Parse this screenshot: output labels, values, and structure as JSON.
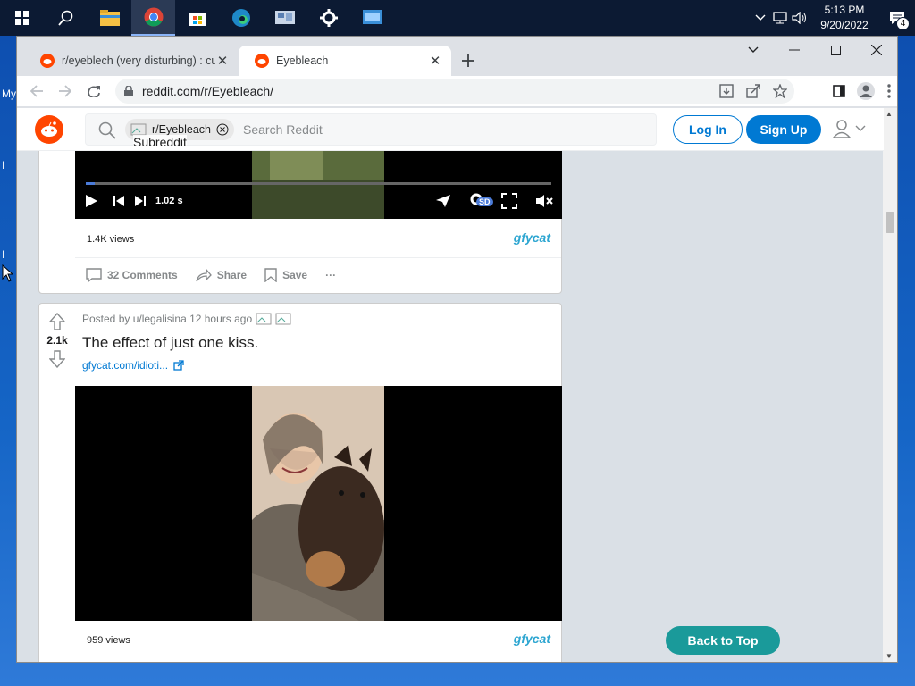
{
  "taskbar": {
    "clock_time": "5:13 PM",
    "clock_date": "9/20/2022",
    "notification_count": "4"
  },
  "desktop": {
    "fragment_1": "My",
    "fragment_2": "I",
    "fragment_3": "I"
  },
  "browser": {
    "tabs": [
      {
        "title": "r/eyeblech (very disturbing) : cur"
      },
      {
        "title": "Eyebleach"
      }
    ],
    "url": "reddit.com/r/Eyebleach/"
  },
  "reddit": {
    "search_chip": "r/Eyebleach",
    "search_placeholder": "Search Reddit",
    "subreddit_tooltip": "Subreddit",
    "login_label": "Log In",
    "signup_label": "Sign Up",
    "back_to_top": "Back to Top"
  },
  "post1": {
    "time_label": "1.02 s",
    "quality_badge": "SD",
    "views": "1.4K views",
    "provider": "gfycat",
    "comments": "32 Comments",
    "share": "Share",
    "save": "Save",
    "more": "···",
    "progress": 0.02
  },
  "post2": {
    "votes": "2.1k",
    "posted_by": "Posted by u/legalisina 12 hours ago",
    "title": "The effect of just one kiss.",
    "link": "gfycat.com/idioti...",
    "views": "959 views",
    "provider": "gfycat"
  },
  "colors": {
    "reddit_orange": "#ff4500",
    "reddit_blue": "#0079d3",
    "back_to_top": "#1a9a9a",
    "gfycat": "#2ea6d1"
  }
}
